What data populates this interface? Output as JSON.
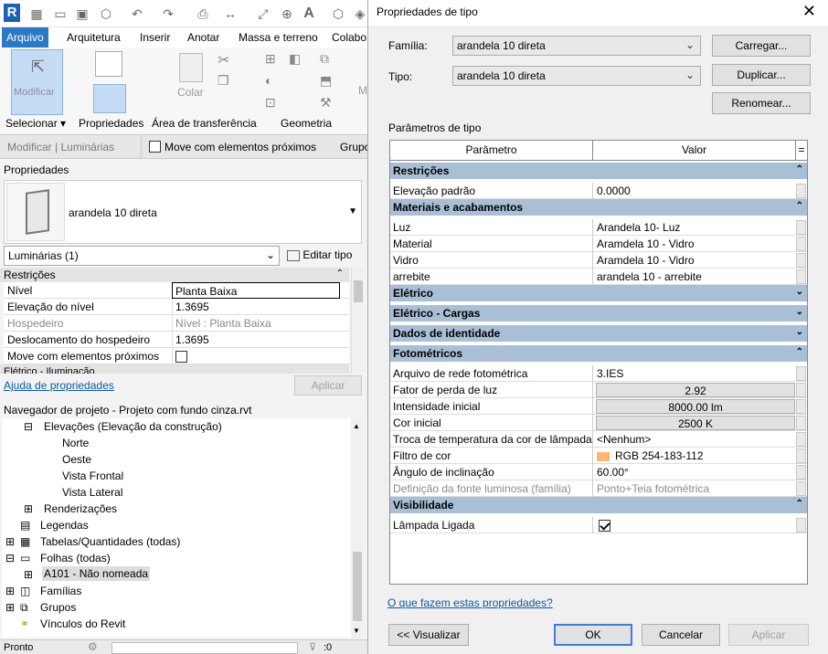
{
  "revit": {
    "menu": [
      "Arquivo",
      "Arquitetura",
      "Inserir",
      "Anotar",
      "Massa e terreno",
      "Colabo"
    ],
    "ribbon": {
      "modify_label": "Modificar",
      "paste_label": "Colar",
      "panels": [
        "Selecionar",
        "Propriedades",
        "Área de transferência",
        "Geometria"
      ],
      "m_label": "M"
    },
    "context": {
      "mode": "Modificar | Luminárias",
      "move_with": "Move com elementos próximos",
      "group": "Grupo"
    },
    "properties": {
      "header": "Propriedades",
      "family_name": "arandela 10 direta",
      "selector": "Luminárias (1)",
      "edit_type": "Editar tipo",
      "section": "Restrições",
      "rows": [
        {
          "k": "Nível",
          "v": "Planta Baixa"
        },
        {
          "k": "Elevação do nível",
          "v": "1.3695"
        },
        {
          "k": "Hospedeiro",
          "v": "Nível : Planta Baixa"
        },
        {
          "k": "Deslocamento do hospedeiro",
          "v": "1.3695"
        },
        {
          "k": "Move com elementos próximos",
          "v": ""
        }
      ],
      "cut_section": "Elétrico - Iluminação",
      "help_link": "Ajuda de propriedades",
      "apply": "Aplicar"
    },
    "navigator": {
      "title": "Navegador de projeto - Projeto com fundo cinza.rvt",
      "items": [
        "Elevações (Elevação da construção)",
        "Norte",
        "Oeste",
        "Vista Frontal",
        "Vista Lateral",
        "Renderizações",
        "Legendas",
        "Tabelas/Quantidades (todas)",
        "Folhas (todas)",
        "A101 - Não nomeada",
        "Famílias",
        "Grupos",
        "Vínculos do Revit"
      ]
    },
    "status": {
      "text": "Pronto",
      "count": ":0"
    }
  },
  "dialog": {
    "title": "Propriedades de tipo",
    "family_label": "Família:",
    "family_value": "arandela 10 direta",
    "type_label": "Tipo:",
    "type_value": "arandela 10 direta",
    "load_btn": "Carregar...",
    "duplicate_btn": "Duplicar...",
    "rename_btn": "Renomear...",
    "params_label": "Parâmetros de tipo",
    "col_param": "Parâmetro",
    "col_value": "Valor",
    "col_eq": "=",
    "groups": [
      {
        "title": "Restrições",
        "toggle": "⌃⌃",
        "rows": [
          {
            "k": "Elevação padrão",
            "v": "0.0000"
          }
        ]
      },
      {
        "title": "Materiais e acabamentos",
        "toggle": "⌃⌃",
        "rows": [
          {
            "k": "Luz",
            "v": "Arandela 10- Luz"
          },
          {
            "k": "Material",
            "v": "Aramdela 10 - Vidro"
          },
          {
            "k": "Vidro",
            "v": "Aramdela 10 - Vidro"
          },
          {
            "k": "arrebite",
            "v": "arandela 10 - arrebite"
          }
        ]
      },
      {
        "title": "Elétrico",
        "toggle": "⌄⌄",
        "rows": []
      },
      {
        "title": "Elétrico - Cargas",
        "toggle": "⌄⌄",
        "rows": []
      },
      {
        "title": "Dados de identidade",
        "toggle": "⌄⌄",
        "rows": []
      },
      {
        "title": "Fotométricos",
        "toggle": "⌃⌃",
        "rows": [
          {
            "k": "Arquivo de rede fotométrica",
            "v": "3.IES"
          },
          {
            "k": "Fator de perda de luz",
            "v": "2.92",
            "btn": true
          },
          {
            "k": "Intensidade inicial",
            "v": "8000.00 lm",
            "btn": true
          },
          {
            "k": "Cor inicial",
            "v": "2500 K",
            "btn": true
          },
          {
            "k": "Troca de temperatura da cor de lâmpada",
            "v": "<Nenhum>"
          },
          {
            "k": "Filtro de cor",
            "v": "RGB 254-183-112",
            "swatch": "#feb770"
          },
          {
            "k": "Ângulo de inclinação",
            "v": "60.00°"
          },
          {
            "k": "Definição da fonte luminosa (família)",
            "v": "Ponto+Teia fotométrica",
            "dim": true
          }
        ]
      },
      {
        "title": "Visibilidade",
        "toggle": "⌃⌃",
        "rows": [
          {
            "k": "Lâmpada Ligada",
            "v": "",
            "check": true
          }
        ]
      }
    ],
    "help_link": "O que fazem estas propriedades?",
    "preview_btn": "<< Visualizar",
    "ok_btn": "OK",
    "cancel_btn": "Cancelar",
    "apply_btn": "Aplicar"
  }
}
